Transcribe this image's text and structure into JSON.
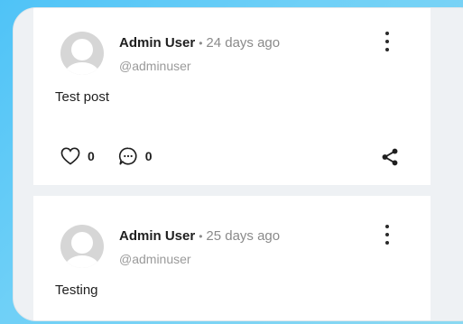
{
  "posts": [
    {
      "author": "Admin User",
      "time": "24 days ago",
      "handle": "@adminuser",
      "text": "Test post",
      "likes": "0",
      "comments": "0"
    },
    {
      "author": "Admin User",
      "time": "25 days ago",
      "handle": "@adminuser",
      "text": "Testing"
    }
  ],
  "separator": "•",
  "icons": {
    "avatar": "avatar-placeholder-icon",
    "menu": "more-vertical-icon",
    "like": "heart-icon",
    "comment": "comment-bubble-icon",
    "share": "share-icon"
  }
}
